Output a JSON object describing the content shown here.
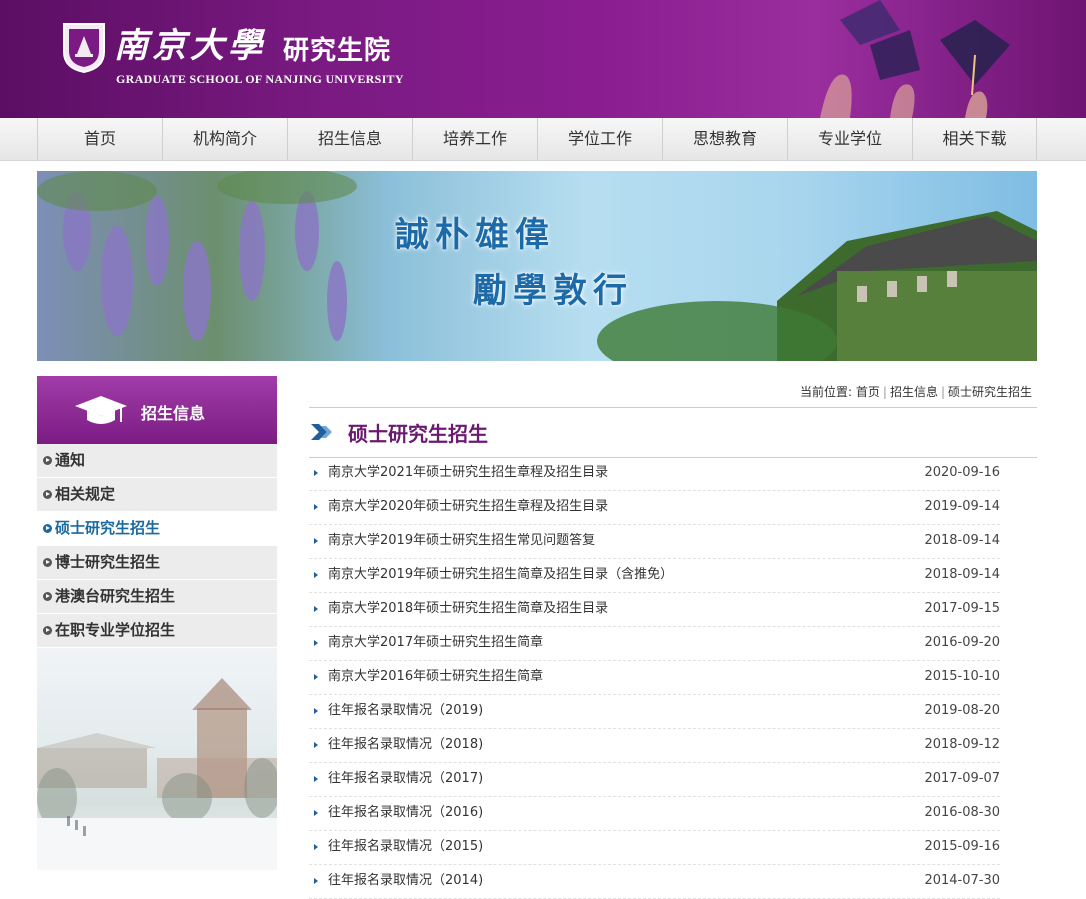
{
  "header": {
    "logo_cn": "南京大學",
    "logo_sub_cn": "研究生院",
    "logo_en": "GRADUATE SCHOOL OF NANJING UNIVERSITY"
  },
  "nav": {
    "items": [
      {
        "label": "首页"
      },
      {
        "label": "机构简介"
      },
      {
        "label": "招生信息"
      },
      {
        "label": "培养工作"
      },
      {
        "label": "学位工作"
      },
      {
        "label": "思想教育"
      },
      {
        "label": "专业学位"
      },
      {
        "label": "相关下载"
      }
    ]
  },
  "banner": {
    "motto_line1": "誠朴雄偉",
    "motto_line2": "勵學敦行"
  },
  "sidebar": {
    "title": "招生信息",
    "items": [
      {
        "label": "通知",
        "active": false
      },
      {
        "label": "相关规定",
        "active": false
      },
      {
        "label": "硕士研究生招生",
        "active": true
      },
      {
        "label": "博士研究生招生",
        "active": false
      },
      {
        "label": "港澳台研究生招生",
        "active": false
      },
      {
        "label": "在职专业学位招生",
        "active": false
      }
    ]
  },
  "breadcrumb": {
    "prefix": "当前位置:",
    "items": [
      "首页",
      "招生信息",
      "硕士研究生招生"
    ]
  },
  "section_title": "硕士研究生招生",
  "articles": [
    {
      "title": "南京大学2021年硕士研究生招生章程及招生目录",
      "date": "2020-09-16"
    },
    {
      "title": "南京大学2020年硕士研究生招生章程及招生目录",
      "date": "2019-09-14"
    },
    {
      "title": "南京大学2019年硕士研究生招生常见问题答复",
      "date": "2018-09-14"
    },
    {
      "title": "南京大学2019年硕士研究生招生简章及招生目录（含推免）",
      "date": "2018-09-14"
    },
    {
      "title": "南京大学2018年硕士研究生招生简章及招生目录",
      "date": "2017-09-15"
    },
    {
      "title": "南京大学2017年硕士研究生招生简章",
      "date": "2016-09-20"
    },
    {
      "title": "南京大学2016年硕士研究生招生简章",
      "date": "2015-10-10"
    },
    {
      "title": "往年报名录取情况（2019)",
      "date": "2019-08-20"
    },
    {
      "title": "往年报名录取情况（2018)",
      "date": "2018-09-12"
    },
    {
      "title": "往年报名录取情况（2017)",
      "date": "2017-09-07"
    },
    {
      "title": "往年报名录取情况（2016)",
      "date": "2016-08-30"
    },
    {
      "title": "往年报名录取情况（2015)",
      "date": "2015-09-16"
    },
    {
      "title": "往年报名录取情况（2014)",
      "date": "2014-07-30"
    }
  ],
  "colors": {
    "header_purple": "#7a1a82",
    "title_purple": "#6a1a70",
    "link_blue": "#1b6aa0"
  }
}
